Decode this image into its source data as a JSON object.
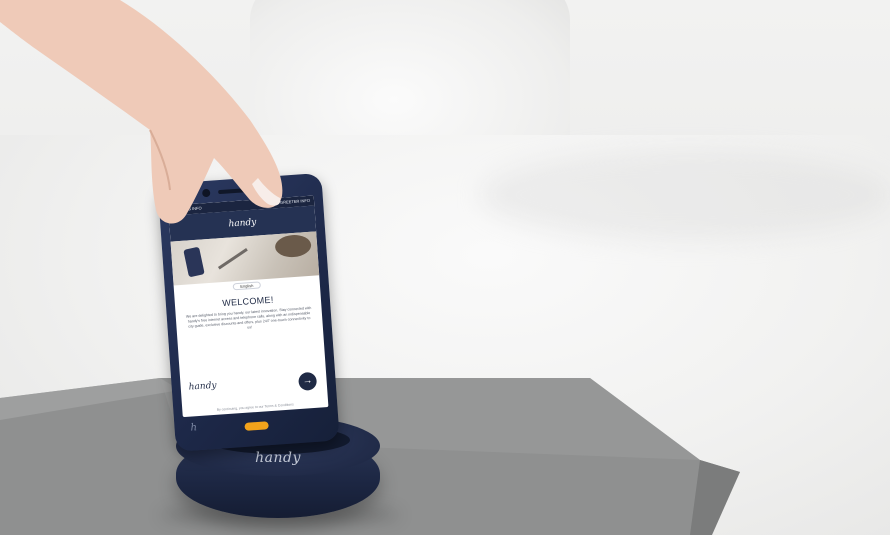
{
  "scene": {
    "description_colors": {
      "wall": "#ededec",
      "sheet": "#f3f3f2",
      "tray": "#8e8f8f",
      "phone_body": "#1d2848",
      "dock": "#1c2642",
      "accent_button": "#f2a31b"
    }
  },
  "phone": {
    "status_left": "BOOKING INFO",
    "status_right": "DIGITAL GREETER INFO",
    "brand": "handy",
    "language": "English",
    "welcome": "WELCOME!",
    "body_text": "We are delighted to bring you handy, our latest innovation. Stay connected with handy's free internet access and telephone calls, along with an indispensable city guide, exclusive discounts and offers, plus 24/7 one-touch connectivity to us!",
    "footer_signature": "handy",
    "next_icon": "arrow-right-icon",
    "terms": "By continuing, you agree to our Terms & Conditions",
    "nav_signature": "h"
  },
  "dock": {
    "logo": "handy"
  }
}
